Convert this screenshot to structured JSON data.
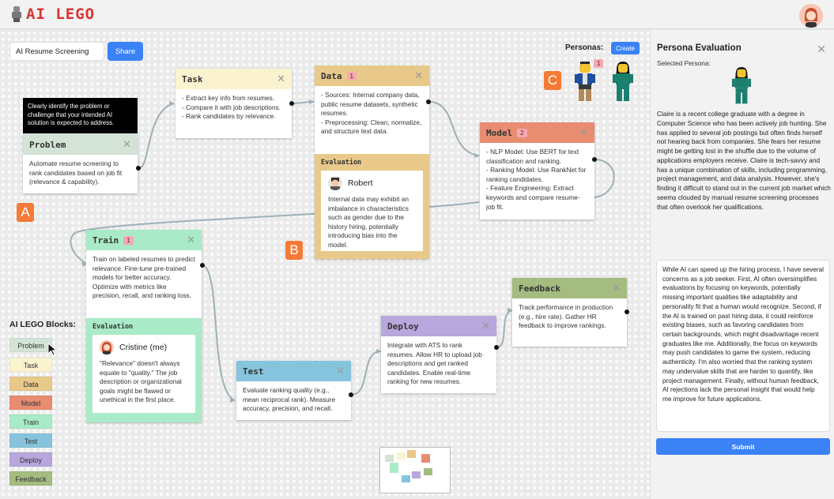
{
  "app": {
    "logo_text": "AI LEGO"
  },
  "toolbar": {
    "project_name": "AI Resume Screening",
    "share_label": "Share"
  },
  "tooltip": {
    "text": "Clearly identify the problem or challenge that your intended AI solution is expected to address."
  },
  "cards": {
    "problem": {
      "title": "Problem",
      "close": "✕",
      "lines": [
        "Automate resume screening to rank candidates based on job fit (relevance & capability)."
      ]
    },
    "task": {
      "title": "Task",
      "close": "✕",
      "lines": [
        "- Extract key info from resumes.",
        "- Compare it with job descriptions.",
        "- Rank candidates by relevance."
      ]
    },
    "data": {
      "title": "Data",
      "badge": "1",
      "close": "✕",
      "lines": [
        "- Sources: Internal company data, public resume datasets, synthetic resumes.",
        "- Preprocessing: Clean, normalize, and structure text data."
      ],
      "evaluation": {
        "title": "Evaluation",
        "name": "Robert",
        "text": "Internal data may exhibit an imbalance in characteristics such as gender due to the history hiring, potentially introducing bias into the model."
      }
    },
    "model": {
      "title": "Model",
      "badge": "2",
      "close": "✕",
      "lines": [
        "- NLP Model: Use BERT for text classification and ranking.",
        "- Ranking Model: Use RankNet for ranking candidates.",
        "- Feature Engineering: Extract keywords and compare resume-job fit."
      ]
    },
    "train": {
      "title": "Train",
      "badge": "1",
      "close": "✕",
      "lines": [
        "Train on labeled resumes to predict relevance. Fine-tune pre-trained models for better accuracy. Optimize with metrics like precision, recall, and ranking loss."
      ],
      "evaluation": {
        "title": "Evaluation",
        "name": "Cristine (me)",
        "text": "\"Relevance\" doesn't always equate to \"quality.\" The job description or organizational goals might be flawed or unethical in the first place."
      }
    },
    "test": {
      "title": "Test",
      "close": "✕",
      "lines": [
        "Evaluate ranking quality (e.g., mean reciprocal rank). Measure accuracy, precision, and recall."
      ]
    },
    "deploy": {
      "title": "Deploy",
      "close": "✕",
      "lines": [
        "Integrate with ATS to rank resumes. Allow HR to upload job descriptions and get ranked candidates. Enable real-time ranking for new resumes."
      ]
    },
    "feedback": {
      "title": "Feedback",
      "close": "✕",
      "lines": [
        "Track performance in production (e.g., hire rate). Gather HR feedback to improve rankings."
      ]
    }
  },
  "annotations": {
    "a": "A",
    "b": "B",
    "c": "C"
  },
  "blocks": {
    "title": "AI LEGO Blocks:",
    "items": [
      {
        "label": "Problem",
        "color": "#d3e3d6"
      },
      {
        "label": "Task",
        "color": "#fbf3cf"
      },
      {
        "label": "Data",
        "color": "#e8c98a"
      },
      {
        "label": "Model",
        "color": "#e88d72"
      },
      {
        "label": "Train",
        "color": "#a9ebc8"
      },
      {
        "label": "Test",
        "color": "#86c4dd"
      },
      {
        "label": "Deploy",
        "color": "#b7a7dc"
      },
      {
        "label": "Feedback",
        "color": "#a4bc80"
      }
    ]
  },
  "personas": {
    "label": "Personas:",
    "create_label": "Create",
    "badge": "1"
  },
  "panel": {
    "title": "Persona Evaluation",
    "close": "✕",
    "selected_label": "Selected Persona:",
    "description": "Claire is a recent college graduate with a degree in Computer Science who has been actively job hunting. She has applied to several job postings but often finds herself not hearing back from companies. She fears her resume might be getting lost in the shuffle due to the volume of applications employers receive. Claire is tech-savvy and has a unique combination of skills, including programming, project management, and data analysis. However, she's finding it difficult to stand out in the current job market which seems clouded by manual resume screening processes that often overlook her qualifications.",
    "feedback": "While AI can speed up the hiring process, I have several concerns as a job seeker. First, AI often oversimplifies evaluations by focusing on keywords, potentially missing important qualities like adaptability and personality fit that a human would recognize. Second, if the AI is trained on past hiring data, it could reinforce existing biases, such as favoring candidates from certain backgrounds, which might disadvantage recent graduates like me. Additionally, the focus on keywords may push candidates to game the system, reducing authenticity. I'm also worried that the ranking system may undervalue skills that are harder to quantify, like project management. Finally, without human feedback, AI rejections lack the personal insight that would help me improve for future applications.",
    "submit_label": "Submit"
  }
}
